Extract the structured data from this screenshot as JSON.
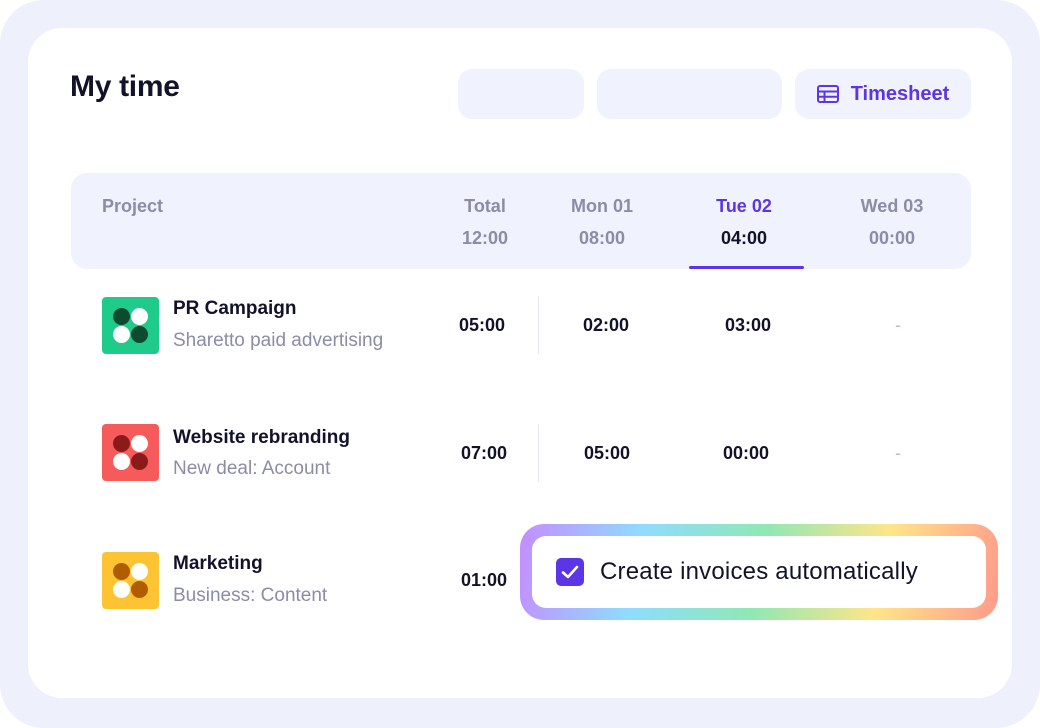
{
  "header": {
    "title": "My time",
    "timesheet_label": "Timesheet"
  },
  "table": {
    "columns": [
      {
        "label": "Project"
      },
      {
        "label": "Total",
        "value": "12:00"
      },
      {
        "label": "Mon 01",
        "value": "08:00"
      },
      {
        "label": "Tue 02",
        "value": "04:00",
        "active": true
      },
      {
        "label": "Wed 03",
        "value": "00:00"
      }
    ],
    "rows": [
      {
        "name": "PR Campaign",
        "subtitle": "Sharetto paid advertising",
        "icon_color": "#1fcb8a",
        "dot_dark": "#0d4a30",
        "total": "05:00",
        "mon": "02:00",
        "tue": "03:00",
        "wed": "-"
      },
      {
        "name": "Website rebranding",
        "subtitle": "New deal: Account",
        "icon_color": "#f65b5b",
        "dot_dark": "#8b1b1b",
        "total": "07:00",
        "mon": "05:00",
        "tue": "00:00",
        "wed": "-"
      },
      {
        "name": "Marketing",
        "subtitle": "Business: Content",
        "icon_color": "#fcc433",
        "dot_dark": "#b05d00",
        "total": "01:00"
      }
    ]
  },
  "invoice": {
    "label": "Create invoices automatically",
    "checked": true
  },
  "colors": {
    "accent": "#5b35e6",
    "text": "#12122a",
    "muted": "#8b8ca7",
    "band": "#f0f2fd"
  }
}
